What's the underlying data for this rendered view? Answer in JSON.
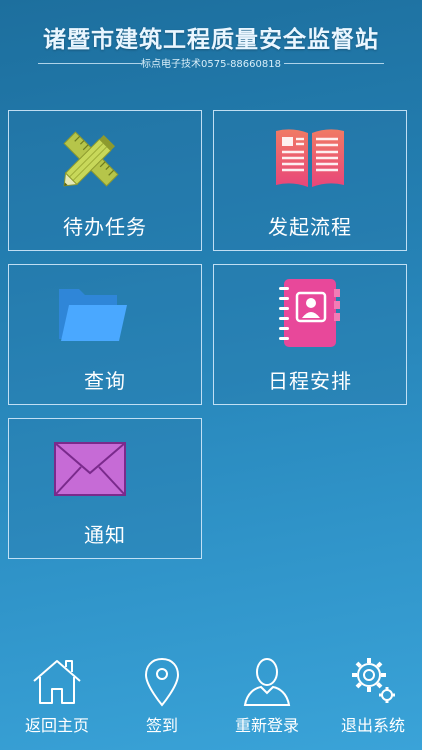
{
  "header": {
    "title": "诸暨市建筑工程质量安全监督站",
    "subtitle": "标点电子技术0575-88660818"
  },
  "tiles": [
    {
      "label": "待办任务",
      "icon": "pencil-ruler-icon"
    },
    {
      "label": "发起流程",
      "icon": "open-book-icon"
    },
    {
      "label": "查询",
      "icon": "folder-icon"
    },
    {
      "label": "日程安排",
      "icon": "address-book-icon"
    },
    {
      "label": "通知",
      "icon": "envelope-icon"
    }
  ],
  "tabbar": [
    {
      "label": "返回主页",
      "icon": "home-icon"
    },
    {
      "label": "签到",
      "icon": "location-pin-icon"
    },
    {
      "label": "重新登录",
      "icon": "user-icon"
    },
    {
      "label": "退出系统",
      "icon": "gear-icon"
    }
  ],
  "colors": {
    "background": "#247fb2",
    "tile_border": "#dcf0ff",
    "pencil": "#b8c94a",
    "book": "#e95a6e",
    "folder": "#4aa8ff",
    "address_book": "#e8489a",
    "envelope": "#c66bd6"
  }
}
